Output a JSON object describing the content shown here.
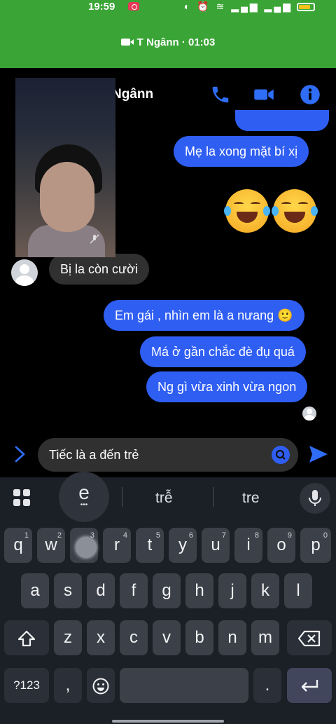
{
  "status_bar": {
    "time": "19:59",
    "icons": [
      "moon-icon",
      "alarm-icon",
      "wifi-icon",
      "signal-icon",
      "signal-icon",
      "battery-icon"
    ]
  },
  "call_banner": {
    "text": "T Ngânn · 01:03",
    "icon": "video-camera-icon",
    "color": "#3aa536"
  },
  "chat_header": {
    "name": "Ngânn",
    "actions": [
      "phone-icon",
      "video-icon",
      "info-icon"
    ],
    "accent": "#2f6df6"
  },
  "messages": [
    {
      "side": "out",
      "text": "Mẹ la xong mặt bí xị"
    },
    {
      "side": "out",
      "emoji": "😂😂"
    },
    {
      "side": "in",
      "text": "Bị la còn cười"
    },
    {
      "side": "out",
      "text": "Em gái , nhìn em là a nưang 🙂"
    },
    {
      "side": "out",
      "text": "Má ở gần chắc đè đụ quá"
    },
    {
      "side": "out",
      "text": "Ng gì vừa xinh vừa ngon"
    }
  ],
  "composer": {
    "value": "Tiếc là a đến trẻ",
    "send_icon": "send-icon",
    "expand_icon": "chevron-right-icon"
  },
  "keyboard": {
    "suggestions": [
      "e",
      "trễ",
      "tre"
    ],
    "row1": [
      {
        "k": "q",
        "n": "1"
      },
      {
        "k": "w",
        "n": "2"
      },
      {
        "k": "e",
        "n": "3"
      },
      {
        "k": "r",
        "n": "4"
      },
      {
        "k": "t",
        "n": "5"
      },
      {
        "k": "y",
        "n": "6"
      },
      {
        "k": "u",
        "n": "7"
      },
      {
        "k": "i",
        "n": "8"
      },
      {
        "k": "o",
        "n": "9"
      },
      {
        "k": "p",
        "n": "0"
      }
    ],
    "row2": [
      "a",
      "s",
      "d",
      "f",
      "g",
      "h",
      "j",
      "k",
      "l"
    ],
    "row3": [
      "z",
      "x",
      "c",
      "v",
      "b",
      "n",
      "m"
    ],
    "symbols_label": "?123",
    "comma": ",",
    "period": "."
  },
  "colors": {
    "outgoing_bubble": "#2f5ef3",
    "incoming_bubble": "#303030",
    "keyboard_bg": "#1b1f26"
  }
}
